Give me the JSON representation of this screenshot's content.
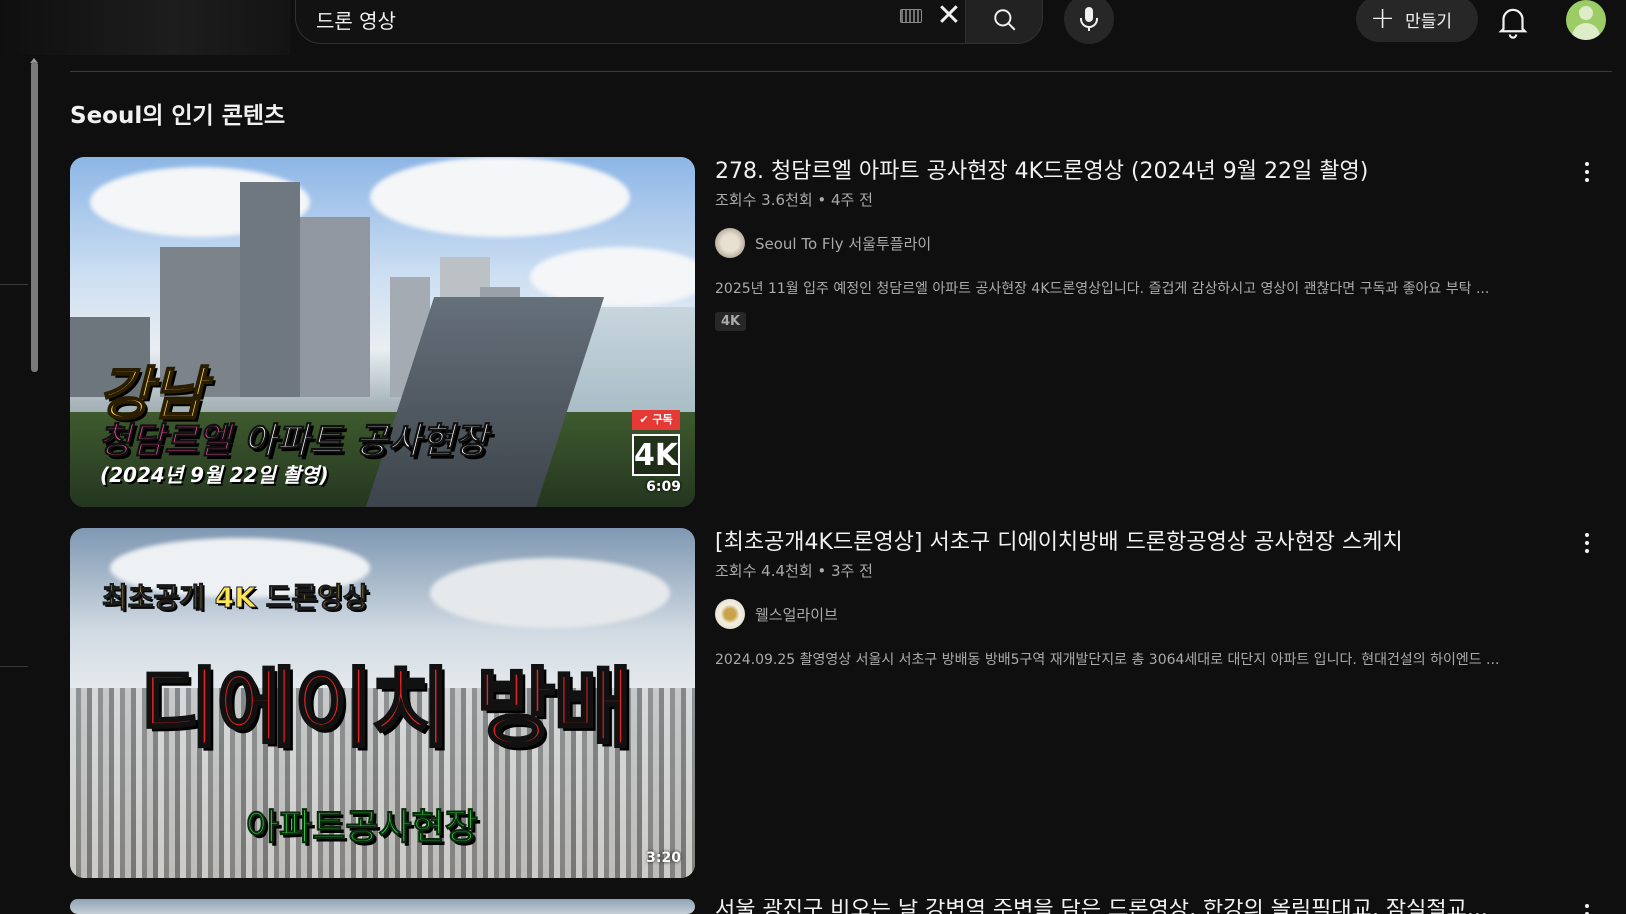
{
  "search": {
    "query": "드론 영상"
  },
  "header": {
    "create_label": "만들기"
  },
  "section": {
    "title": "Seoul의 인기 콘텐츠"
  },
  "videos": [
    {
      "title": "278. 청담르엘 아파트 공사현장 4K드론영상 (2024년 9월 22일 촬영)",
      "meta": "조회수 3.6천회 • 4주 전",
      "channel": "Seoul To Fly 서울투플라이",
      "description": "2025년 11월 입주 예정인 청담르엘 아파트 공사현장 4K드론영상입니다. 즐겁게 감상하시고 영상이 괜찮다면 구독과 좋아요 부탁 ...",
      "badge": "4K",
      "duration": "6:09",
      "thumb_text": {
        "line1": "강남",
        "line2_pink": "청담르엘",
        "line2_white": " 아파트 공사현장",
        "line3": "(2024년 9월 22일 촬영)",
        "quality": "4K",
        "subscribe": "✔ 구독"
      }
    },
    {
      "title": "[최초공개4K드론영상] 서초구 디에이치방배 드론항공영상 공사현장 스케치",
      "meta": "조회수 4.4천회 • 3주 전",
      "channel": "웰스얼라이브",
      "description": "2024.09.25 촬영영상 서울시 서초구 방배동 방배5구역 재개발단지로 총 3064세대로 대단지 아파트 입니다. 현대건설의 하이엔드 ...",
      "duration": "3:20",
      "thumb_text": {
        "line1": "최초공개 4K 드론영상",
        "big": "디에이치 방배",
        "line3": "아파트공사현장"
      }
    },
    {
      "title": "서울 광진구 비오는 날 강변역 주변을 담은 드론영상, 한강의 올림픽대교, 잠실철교..."
    }
  ],
  "colors": {
    "background": "#0f0f0f",
    "text_primary": "#f1f1f1",
    "text_secondary": "#aaaaaa",
    "avatar": "#9ccc65"
  }
}
